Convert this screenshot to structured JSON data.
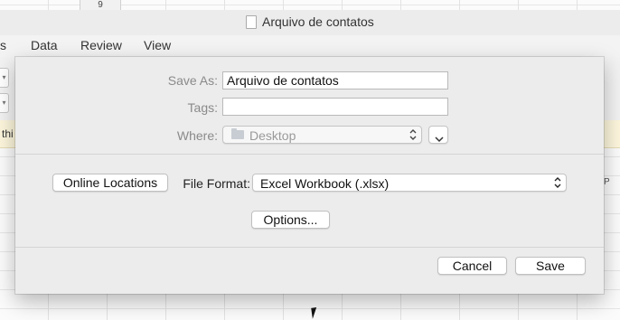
{
  "spreadsheet": {
    "row_number_top": "9",
    "column_header_right": "P",
    "info_text_fragment": "thi"
  },
  "window": {
    "title": "Arquivo de contatos"
  },
  "menu": {
    "items": [
      "s",
      "Data",
      "Review",
      "View"
    ]
  },
  "dialog": {
    "save_as_label": "Save As:",
    "save_as_value": "Arquivo de contatos",
    "tags_label": "Tags:",
    "tags_value": "",
    "where_label": "Where:",
    "where_value": "Desktop",
    "online_locations_label": "Online Locations",
    "file_format_label": "File Format:",
    "file_format_value": "Excel Workbook (.xlsx)",
    "options_label": "Options...",
    "cancel_label": "Cancel",
    "save_label": "Save"
  },
  "icons": {
    "document": "document-icon",
    "folder": "folder-icon",
    "updown": "updown-chevron-icon",
    "chevron": "chevron-down-icon",
    "cursor": "mouse-pointer-icon"
  },
  "colors": {
    "dialog_bg": "#ececec",
    "info_bar_bg": "#fdf6dc",
    "disabled_text": "#8a8a8a"
  }
}
